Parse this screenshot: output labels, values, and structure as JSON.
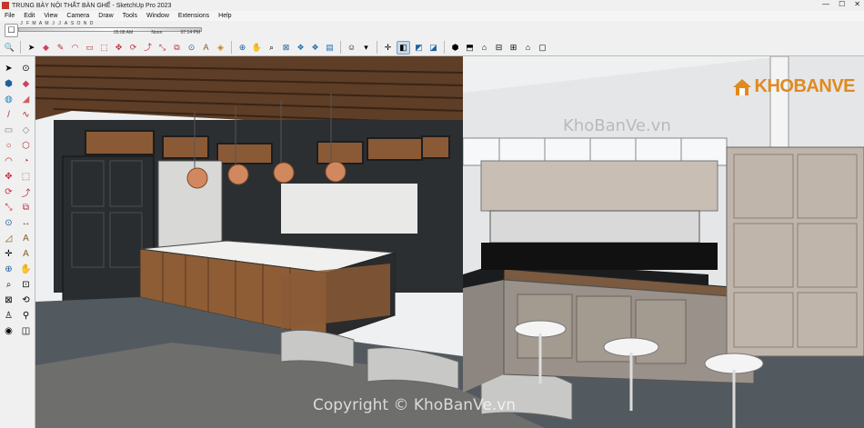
{
  "window": {
    "title": "TRUNG BÀY NỘI THẤT BÀN GHẾ - SketchUp Pro 2023"
  },
  "menu": [
    "File",
    "Edit",
    "View",
    "Camera",
    "Draw",
    "Tools",
    "Window",
    "Extensions",
    "Help"
  ],
  "shadow": {
    "months": [
      "J",
      "F",
      "M",
      "A",
      "M",
      "J",
      "J",
      "A",
      "S",
      "O",
      "N",
      "D"
    ],
    "time_start": "05:08 AM",
    "time_noon": "Noon",
    "time_end": "07:14 PM"
  },
  "logo": {
    "text": "KHOBANVE"
  },
  "watermarks": {
    "top": "KhoBanVe.vn",
    "bottom": "Copyright © KhoBanVe.vn"
  }
}
